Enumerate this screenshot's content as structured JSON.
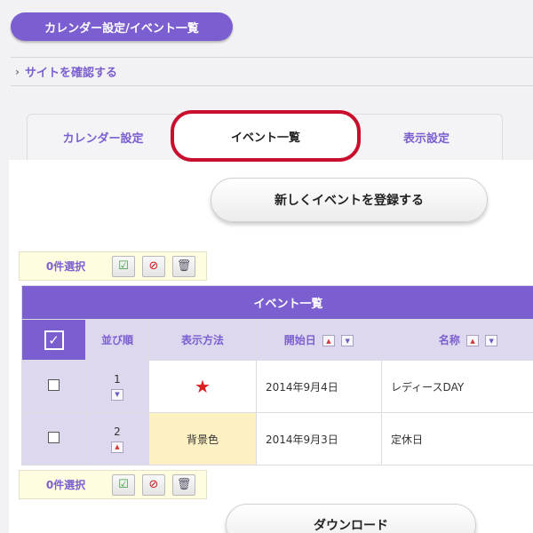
{
  "header": {
    "title": "カレンダー設定/イベント一覧",
    "site_link": "サイトを確認する"
  },
  "tabs": [
    {
      "label": "カレンダー設定",
      "active": false
    },
    {
      "label": "イベント一覧",
      "active": true
    },
    {
      "label": "表示設定",
      "active": false
    }
  ],
  "actions": {
    "register_label": "新しくイベントを登録する",
    "download_label": "ダウンロード"
  },
  "selection": {
    "top_count": "0件選択",
    "bottom_count": "0件選択"
  },
  "table": {
    "caption": "イベント一覧",
    "columns": [
      "並び順",
      "表示方法",
      "開始日",
      "名称"
    ],
    "rows": [
      {
        "order": "1",
        "method": "★",
        "start_date": "2014年9月4日",
        "name": "レディースDAY"
      },
      {
        "order": "2",
        "method": "背景色",
        "start_date": "2014年9月3日",
        "name": "定休日"
      }
    ]
  },
  "colors": {
    "accent": "#7b5fd0",
    "header_bg": "#ddd8ee",
    "highlight": "#c8102e",
    "method_bg": "#fdf0c3"
  }
}
